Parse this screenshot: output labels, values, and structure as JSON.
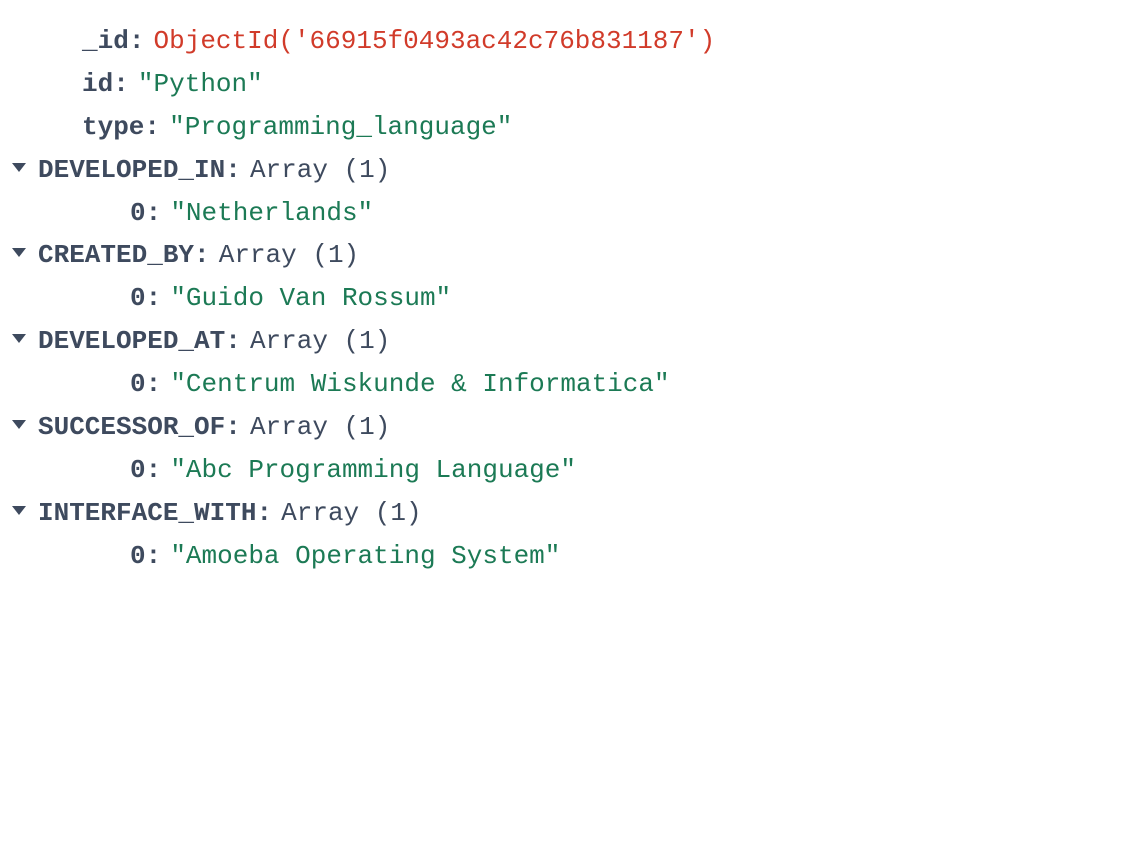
{
  "fields": {
    "objectid_key": "_id",
    "objectid_prefix": "ObjectId('",
    "objectid_value": "66915f0493ac42c76b831187",
    "objectid_suffix": "')",
    "id_key": "id ",
    "id_value": "\"Python\"",
    "type_key": "type ",
    "type_value": "\"Programming_language\"",
    "developed_in_key": "DEVELOPED_IN ",
    "developed_in_type": "Array (1)",
    "developed_in_0_idx": "0",
    "developed_in_0_val": "\"Netherlands\"",
    "created_by_key": "CREATED_BY ",
    "created_by_type": "Array (1)",
    "created_by_0_idx": "0",
    "created_by_0_val": "\"Guido Van Rossum\"",
    "developed_at_key": "DEVELOPED_AT ",
    "developed_at_type": "Array (1)",
    "developed_at_0_idx": "0",
    "developed_at_0_val": "\"Centrum Wiskunde & Informatica\"",
    "successor_of_key": "SUCCESSOR_OF ",
    "successor_of_type": "Array (1)",
    "successor_of_0_idx": "0",
    "successor_of_0_val": "\"Abc Programming Language\"",
    "interface_with_key": "INTERFACE_WITH ",
    "interface_with_type": "Array (1)",
    "interface_with_0_idx": "0",
    "interface_with_0_val": "\"Amoeba Operating System\""
  }
}
